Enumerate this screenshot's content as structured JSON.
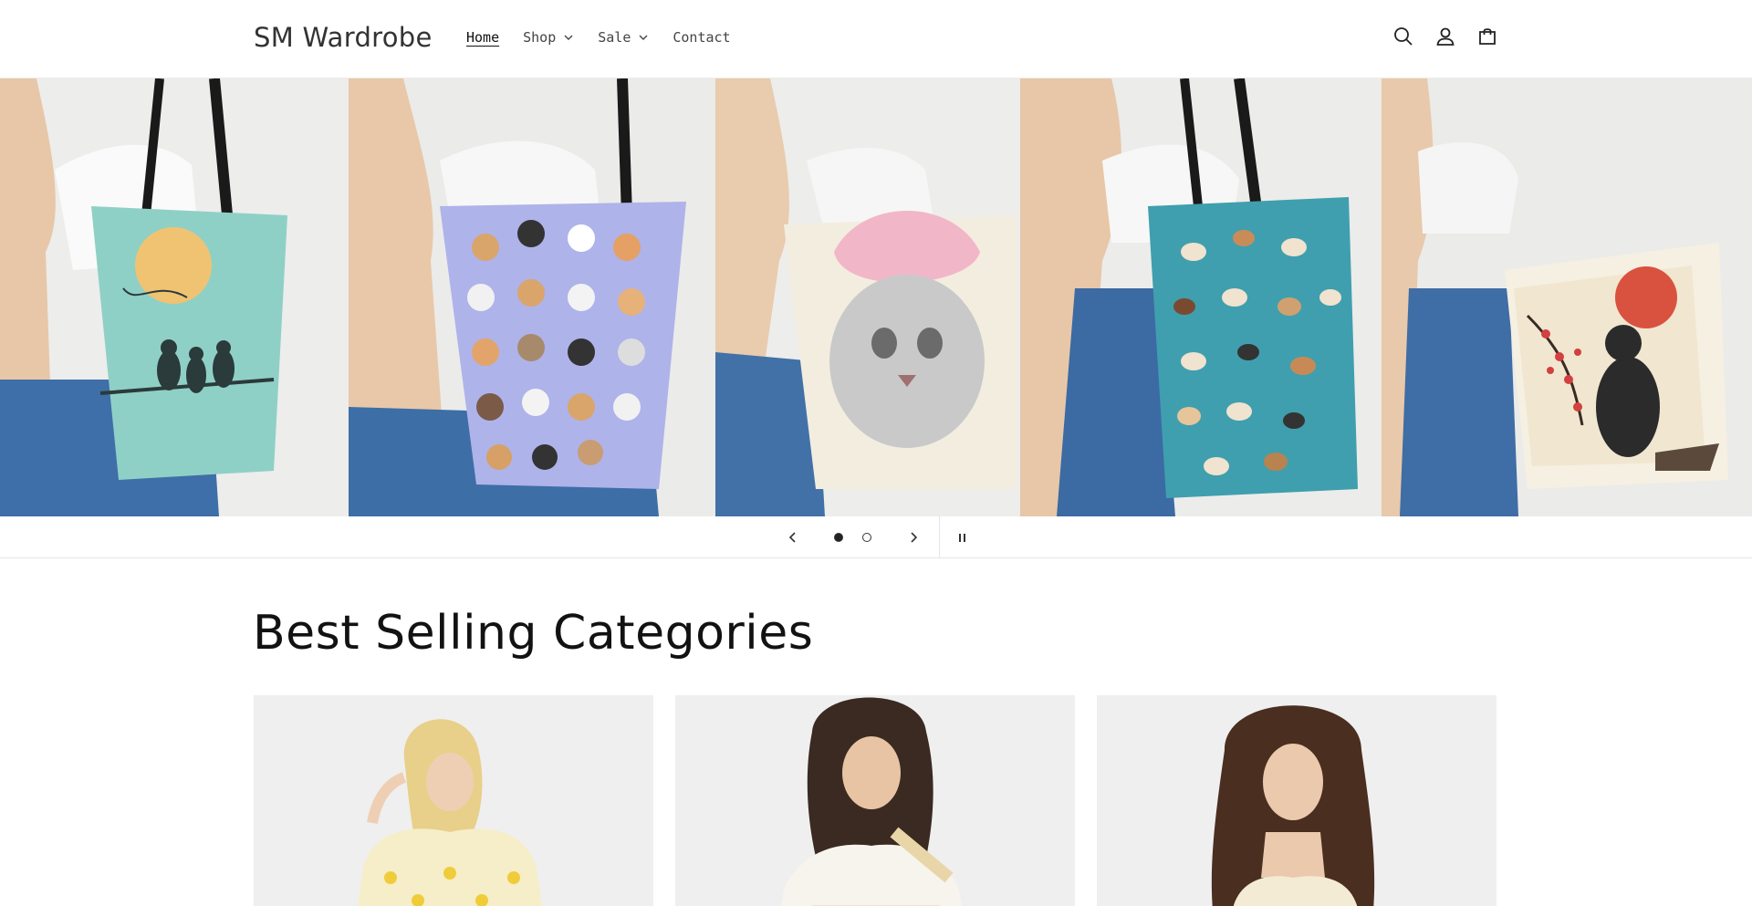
{
  "header": {
    "logo": "SM Wardrobe",
    "nav": [
      {
        "label": "Home",
        "active": true,
        "dropdown": false
      },
      {
        "label": "Shop",
        "active": false,
        "dropdown": true
      },
      {
        "label": "Sale",
        "active": false,
        "dropdown": true
      },
      {
        "label": "Contact",
        "active": false,
        "dropdown": false
      }
    ],
    "icons": [
      "search-icon",
      "account-icon",
      "cart-icon"
    ]
  },
  "hero": {
    "slides_total": 2,
    "current_slide": 1,
    "panels": [
      {
        "bag": "cats-on-branch-moon-tote",
        "color": "#8fd0c6"
      },
      {
        "bag": "cat-faces-pattern-tote",
        "color": "#aeb3ea"
      },
      {
        "bag": "cat-with-pink-bandana-tote",
        "color": "#f3ede0"
      },
      {
        "bag": "dogs-pattern-tote",
        "color": "#3f9fae"
      },
      {
        "bag": "cat-cherry-blossom-sun-tote",
        "color": "#f1e6d0"
      }
    ],
    "controls": {
      "prev_icon": "chevron-left-icon",
      "next_icon": "chevron-right-icon",
      "pause_icon": "pause-icon"
    }
  },
  "section": {
    "title": "Best Selling Categories",
    "cards": [
      {
        "image": "woman-in-lemon-print-shirt"
      },
      {
        "image": "woman-in-floral-overalls"
      },
      {
        "image": "woman-in-cream-top"
      }
    ]
  },
  "colors": {
    "text": "#121212",
    "border": "#e6e6e6",
    "card_bg": "#efefef"
  }
}
